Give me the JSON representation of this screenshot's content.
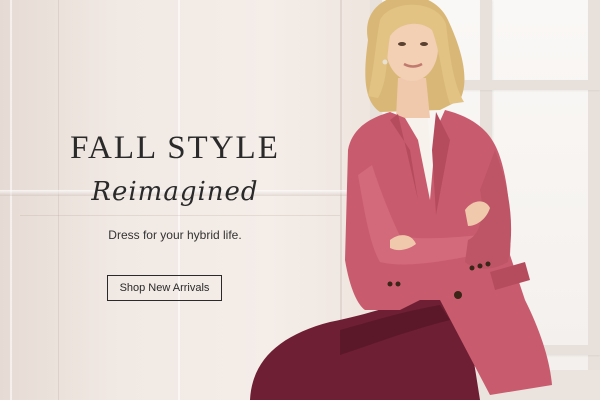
{
  "hero": {
    "headline": "FALL STYLE",
    "script_heading": "Reimagined",
    "subtitle": "Dress for your hybrid life.",
    "cta_label": "Shop New Arrivals"
  },
  "colors": {
    "text": "#2a2a2a",
    "blazer": "#c85c6e",
    "pants": "#6e1f34",
    "background": "#efe6e0"
  }
}
